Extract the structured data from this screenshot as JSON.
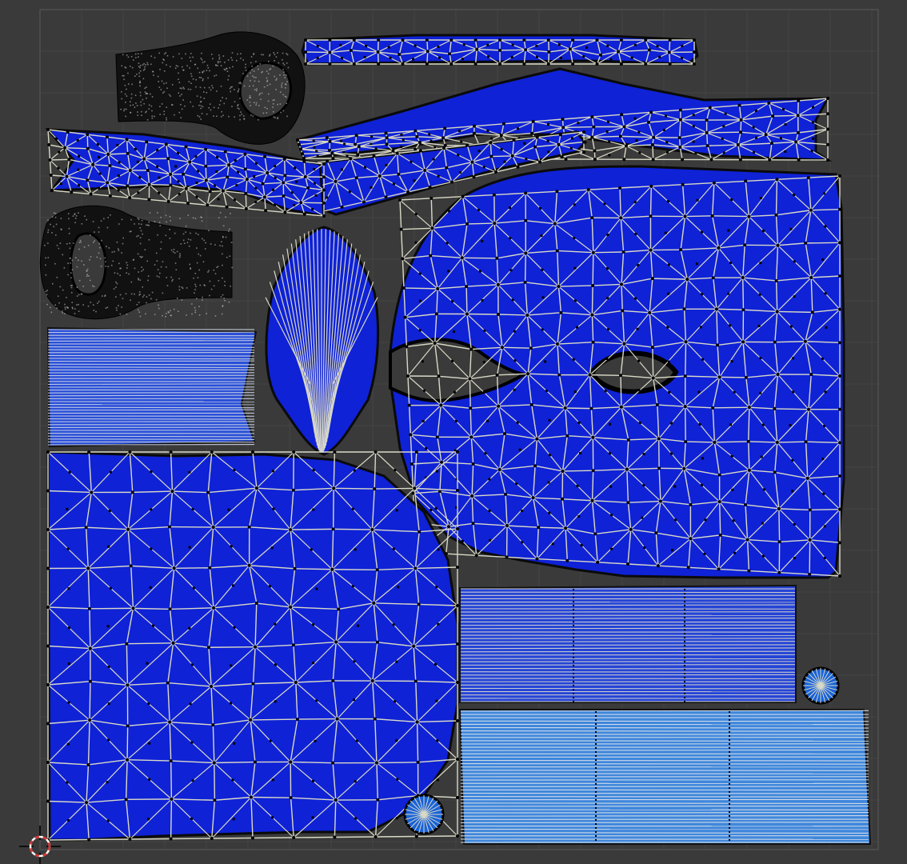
{
  "editor": {
    "type": "uv-editor",
    "background_color": "#3a3a3a",
    "grid_color": "#444444",
    "grid_major_color": "#4a4a4a",
    "mesh_fill_color": "#0f22d6",
    "mesh_fill_light_color": "#1a63d8",
    "edge_color": "#d9d9c7",
    "vertex_color": "#000000",
    "boundary_color": "#0a0a0a"
  },
  "islands": [
    {
      "name": "ring-top-left",
      "kind": "ring-dense"
    },
    {
      "name": "strip-top",
      "kind": "strip"
    },
    {
      "name": "arm-long-right",
      "kind": "arm"
    },
    {
      "name": "arm-small-mid",
      "kind": "arm"
    },
    {
      "name": "arm-left",
      "kind": "arm"
    },
    {
      "name": "ring-mid-left",
      "kind": "ring-dense"
    },
    {
      "name": "fan-lines-left",
      "kind": "lines"
    },
    {
      "name": "lens-center",
      "kind": "lens"
    },
    {
      "name": "head-large",
      "kind": "head"
    },
    {
      "name": "body-large",
      "kind": "body"
    },
    {
      "name": "rect-lines-mid",
      "kind": "lines"
    },
    {
      "name": "rect-lines-bottom",
      "kind": "lines"
    },
    {
      "name": "disc-small-right",
      "kind": "disc"
    },
    {
      "name": "disc-small-bottom",
      "kind": "disc"
    }
  ],
  "cursor": {
    "icon": "3d-cursor-icon",
    "color_a": "#e23030",
    "color_b": "#ffffff"
  }
}
